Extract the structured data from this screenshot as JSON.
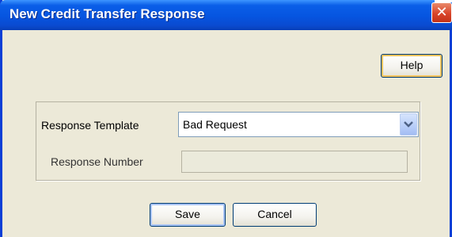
{
  "window": {
    "title": "New Credit Transfer Response",
    "close_glyph": "✕"
  },
  "toolbar": {
    "help_label": "Help"
  },
  "form": {
    "template_label": "Response Template",
    "template_value": "Bad Request",
    "number_label": "Response Number",
    "number_value": ""
  },
  "actions": {
    "save_label": "Save",
    "cancel_label": "Cancel"
  },
  "colors": {
    "titlebar": "#0655e0",
    "window_bg": "#ece9d8",
    "close_button": "#d9442a"
  },
  "icons": {
    "close": "close-icon",
    "dropdown": "chevron-down-icon"
  }
}
